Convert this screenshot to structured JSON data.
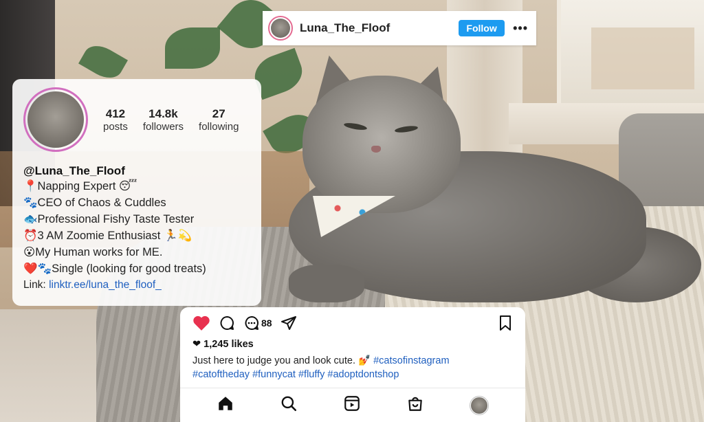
{
  "header": {
    "username": "Luna_The_Floof",
    "follow_label": "Follow",
    "more_label": "•••"
  },
  "profile": {
    "stats": [
      {
        "value": "412",
        "label": "posts"
      },
      {
        "value": "14.8k",
        "label": "followers"
      },
      {
        "value": "27",
        "label": "following"
      }
    ],
    "handle": "@Luna_The_Floof",
    "bio": [
      {
        "emoji": "📍",
        "text": "Napping Expert 😴"
      },
      {
        "emoji": "🐾",
        "text": "CEO of Chaos & Cuddles"
      },
      {
        "emoji": "🐟",
        "text": "Professional Fishy Taste Tester"
      },
      {
        "emoji": "⏰",
        "text": "3 AM Zoomie Enthusiast 🏃💫"
      },
      {
        "emoji": "😮",
        "text": "My Human works for ME."
      },
      {
        "emoji": "❤️🐾",
        "text": "Single (looking for good treats)"
      }
    ],
    "link_label": "Link:",
    "link_text": "linktr.ee/luna_the_floof_"
  },
  "post": {
    "comment_count": "88",
    "likes_text": "❤ 1,245 likes",
    "caption_text": "Just here to judge you and look cute. 💅",
    "hashtags_line1": "#catsofinstagram",
    "hashtags_line2": "#catoftheday #funnycat #fluffy #adoptdontshop",
    "liked": true
  },
  "icons": {
    "heart": "heart-icon",
    "comment": "comment-icon",
    "comments": "comments-count-icon",
    "share": "share-icon",
    "bookmark": "bookmark-icon",
    "home": "home-icon",
    "search": "search-icon",
    "reels": "reels-icon",
    "shop": "shop-icon"
  },
  "colors": {
    "accent": "#1d9bf0",
    "like_red": "#e8314f",
    "link_blue": "#1f5fbf"
  }
}
